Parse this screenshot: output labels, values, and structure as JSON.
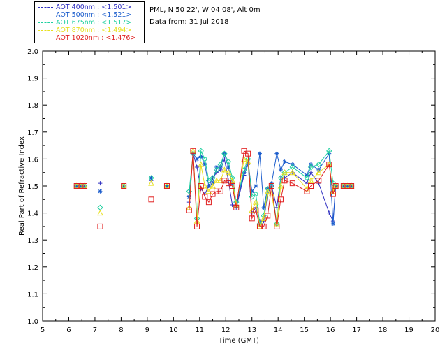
{
  "header": {
    "site": "PML, N 50 22', W 04 08', Alt 0m",
    "date": "Data from: 31 Jul 2018"
  },
  "chart_data": {
    "type": "scatter",
    "title": "",
    "xlabel": "Time (GMT)",
    "ylabel": "Real Part of Refractive Index",
    "xlim": [
      5,
      20
    ],
    "ylim": [
      1.0,
      2.0
    ],
    "xticks": [
      "5",
      "6",
      "7",
      "8",
      "9",
      "10",
      "11",
      "12",
      "13",
      "14",
      "15",
      "16",
      "17",
      "18",
      "19",
      "20"
    ],
    "yticks": [
      "1.0",
      "1.1",
      "1.2",
      "1.3",
      "1.4",
      "1.5",
      "1.6",
      "1.7",
      "1.8",
      "1.9",
      "2.0"
    ],
    "grid": false,
    "legend_position": "top-left outside",
    "series": [
      {
        "name": "AOT 400nm : <1.501>",
        "color": "#3030c0",
        "marker": "plus",
        "points": [
          [
            6.3,
            1.5
          ],
          [
            6.45,
            1.5
          ],
          [
            6.6,
            1.5
          ],
          [
            7.2,
            1.51
          ],
          [
            8.1,
            1.5
          ],
          [
            9.15,
            1.52
          ],
          [
            9.75,
            1.5
          ],
          [
            10.6,
            1.44
          ],
          [
            10.75,
            1.62
          ],
          [
            10.9,
            1.57
          ],
          [
            11.05,
            1.49
          ],
          [
            11.2,
            1.47
          ],
          [
            11.35,
            1.5
          ],
          [
            11.5,
            1.53
          ],
          [
            11.65,
            1.55
          ],
          [
            11.8,
            1.56
          ],
          [
            11.95,
            1.6
          ],
          [
            12.1,
            1.52
          ],
          [
            12.25,
            1.43
          ],
          [
            12.4,
            1.42
          ],
          [
            12.7,
            1.54
          ],
          [
            12.85,
            1.58
          ],
          [
            13.0,
            1.4
          ],
          [
            13.15,
            1.42
          ],
          [
            13.3,
            1.37
          ],
          [
            13.45,
            1.37
          ],
          [
            13.6,
            1.47
          ],
          [
            13.75,
            1.5
          ],
          [
            13.95,
            1.42
          ],
          [
            14.1,
            1.53
          ],
          [
            14.25,
            1.53
          ],
          [
            14.55,
            1.55
          ],
          [
            15.1,
            1.51
          ],
          [
            15.25,
            1.55
          ],
          [
            15.55,
            1.51
          ],
          [
            15.95,
            1.4
          ],
          [
            16.1,
            1.37
          ],
          [
            16.2,
            1.5
          ],
          [
            16.5,
            1.5
          ],
          [
            16.65,
            1.5
          ],
          [
            16.8,
            1.5
          ]
        ]
      },
      {
        "name": "AOT 500nm : <1.521>",
        "color": "#1a5ccc",
        "marker": "asterisk",
        "points": [
          [
            6.3,
            1.5
          ],
          [
            6.45,
            1.5
          ],
          [
            6.6,
            1.5
          ],
          [
            7.2,
            1.48
          ],
          [
            8.1,
            1.5
          ],
          [
            9.15,
            1.53
          ],
          [
            9.75,
            1.5
          ],
          [
            10.6,
            1.46
          ],
          [
            10.75,
            1.62
          ],
          [
            10.9,
            1.6
          ],
          [
            11.05,
            1.61
          ],
          [
            11.2,
            1.58
          ],
          [
            11.35,
            1.5
          ],
          [
            11.5,
            1.51
          ],
          [
            11.65,
            1.57
          ],
          [
            11.8,
            1.57
          ],
          [
            11.95,
            1.62
          ],
          [
            12.1,
            1.57
          ],
          [
            12.25,
            1.51
          ],
          [
            12.4,
            1.43
          ],
          [
            12.7,
            1.55
          ],
          [
            12.85,
            1.59
          ],
          [
            13.0,
            1.48
          ],
          [
            13.15,
            1.5
          ],
          [
            13.3,
            1.62
          ],
          [
            13.45,
            1.42
          ],
          [
            13.6,
            1.49
          ],
          [
            13.75,
            1.51
          ],
          [
            13.95,
            1.62
          ],
          [
            14.1,
            1.56
          ],
          [
            14.25,
            1.59
          ],
          [
            14.55,
            1.58
          ],
          [
            15.1,
            1.54
          ],
          [
            15.25,
            1.58
          ],
          [
            15.55,
            1.56
          ],
          [
            15.95,
            1.62
          ],
          [
            16.1,
            1.36
          ],
          [
            16.2,
            1.5
          ],
          [
            16.5,
            1.5
          ],
          [
            16.65,
            1.5
          ],
          [
            16.8,
            1.5
          ]
        ]
      },
      {
        "name": "AOT 675nm : <1.517>",
        "color": "#20d0a0",
        "marker": "diamond",
        "points": [
          [
            6.3,
            1.5
          ],
          [
            6.45,
            1.5
          ],
          [
            6.6,
            1.5
          ],
          [
            7.2,
            1.42
          ],
          [
            8.1,
            1.5
          ],
          [
            9.15,
            1.53
          ],
          [
            9.75,
            1.5
          ],
          [
            10.6,
            1.48
          ],
          [
            10.75,
            1.62
          ],
          [
            10.9,
            1.38
          ],
          [
            11.05,
            1.63
          ],
          [
            11.2,
            1.6
          ],
          [
            11.35,
            1.52
          ],
          [
            11.5,
            1.53
          ],
          [
            11.65,
            1.56
          ],
          [
            11.8,
            1.58
          ],
          [
            11.95,
            1.62
          ],
          [
            12.1,
            1.59
          ],
          [
            12.25,
            1.53
          ],
          [
            12.4,
            1.44
          ],
          [
            12.7,
            1.56
          ],
          [
            12.85,
            1.6
          ],
          [
            13.0,
            1.46
          ],
          [
            13.15,
            1.47
          ],
          [
            13.3,
            1.36
          ],
          [
            13.45,
            1.39
          ],
          [
            13.6,
            1.49
          ],
          [
            13.75,
            1.5
          ],
          [
            13.95,
            1.36
          ],
          [
            14.1,
            1.53
          ],
          [
            14.25,
            1.55
          ],
          [
            14.55,
            1.57
          ],
          [
            15.1,
            1.53
          ],
          [
            15.25,
            1.57
          ],
          [
            15.55,
            1.58
          ],
          [
            15.95,
            1.63
          ],
          [
            16.1,
            1.51
          ],
          [
            16.2,
            1.5
          ],
          [
            16.5,
            1.5
          ],
          [
            16.65,
            1.5
          ],
          [
            16.8,
            1.5
          ]
        ]
      },
      {
        "name": "AOT 870nm : <1.494>",
        "color": "#e8e020",
        "marker": "triangle",
        "points": [
          [
            6.3,
            1.5
          ],
          [
            6.45,
            1.5
          ],
          [
            6.6,
            1.5
          ],
          [
            7.2,
            1.4
          ],
          [
            8.1,
            1.5
          ],
          [
            9.15,
            1.51
          ],
          [
            9.75,
            1.5
          ],
          [
            10.6,
            1.42
          ],
          [
            10.75,
            1.63
          ],
          [
            10.9,
            1.37
          ],
          [
            11.05,
            1.58
          ],
          [
            11.2,
            1.5
          ],
          [
            11.35,
            1.48
          ],
          [
            11.5,
            1.5
          ],
          [
            11.65,
            1.52
          ],
          [
            11.8,
            1.52
          ],
          [
            11.95,
            1.56
          ],
          [
            12.1,
            1.55
          ],
          [
            12.25,
            1.52
          ],
          [
            12.4,
            1.43
          ],
          [
            12.7,
            1.6
          ],
          [
            12.85,
            1.59
          ],
          [
            13.0,
            1.41
          ],
          [
            13.15,
            1.44
          ],
          [
            13.3,
            1.35
          ],
          [
            13.45,
            1.38
          ],
          [
            13.6,
            1.48
          ],
          [
            13.75,
            1.47
          ],
          [
            13.95,
            1.36
          ],
          [
            14.1,
            1.5
          ],
          [
            14.25,
            1.55
          ],
          [
            14.55,
            1.55
          ],
          [
            15.1,
            1.49
          ],
          [
            15.25,
            1.52
          ],
          [
            15.55,
            1.55
          ],
          [
            15.95,
            1.58
          ],
          [
            16.1,
            1.48
          ],
          [
            16.2,
            1.5
          ],
          [
            16.5,
            1.5
          ],
          [
            16.65,
            1.5
          ],
          [
            16.8,
            1.5
          ]
        ]
      },
      {
        "name": "AOT 1020nm : <1.476>",
        "color": "#e02020",
        "marker": "square",
        "points": [
          [
            6.3,
            1.5
          ],
          [
            6.45,
            1.5
          ],
          [
            6.6,
            1.5
          ],
          [
            7.2,
            1.35
          ],
          [
            8.1,
            1.5
          ],
          [
            9.15,
            1.45
          ],
          [
            9.75,
            1.5
          ],
          [
            10.6,
            1.41
          ],
          [
            10.75,
            1.63
          ],
          [
            10.9,
            1.35
          ],
          [
            11.05,
            1.5
          ],
          [
            11.2,
            1.46
          ],
          [
            11.35,
            1.44
          ],
          [
            11.5,
            1.47
          ],
          [
            11.65,
            1.48
          ],
          [
            11.8,
            1.48
          ],
          [
            11.95,
            1.52
          ],
          [
            12.1,
            1.51
          ],
          [
            12.25,
            1.5
          ],
          [
            12.4,
            1.42
          ],
          [
            12.7,
            1.63
          ],
          [
            12.85,
            1.62
          ],
          [
            13.0,
            1.38
          ],
          [
            13.15,
            1.41
          ],
          [
            13.3,
            1.35
          ],
          [
            13.45,
            1.35
          ],
          [
            13.6,
            1.39
          ],
          [
            13.75,
            1.5
          ],
          [
            13.95,
            1.35
          ],
          [
            14.1,
            1.45
          ],
          [
            14.25,
            1.52
          ],
          [
            14.55,
            1.51
          ],
          [
            15.1,
            1.48
          ],
          [
            15.25,
            1.5
          ],
          [
            15.55,
            1.52
          ],
          [
            15.95,
            1.58
          ],
          [
            16.1,
            1.47
          ],
          [
            16.2,
            1.5
          ],
          [
            16.5,
            1.5
          ],
          [
            16.65,
            1.5
          ],
          [
            16.8,
            1.5
          ]
        ]
      }
    ]
  }
}
